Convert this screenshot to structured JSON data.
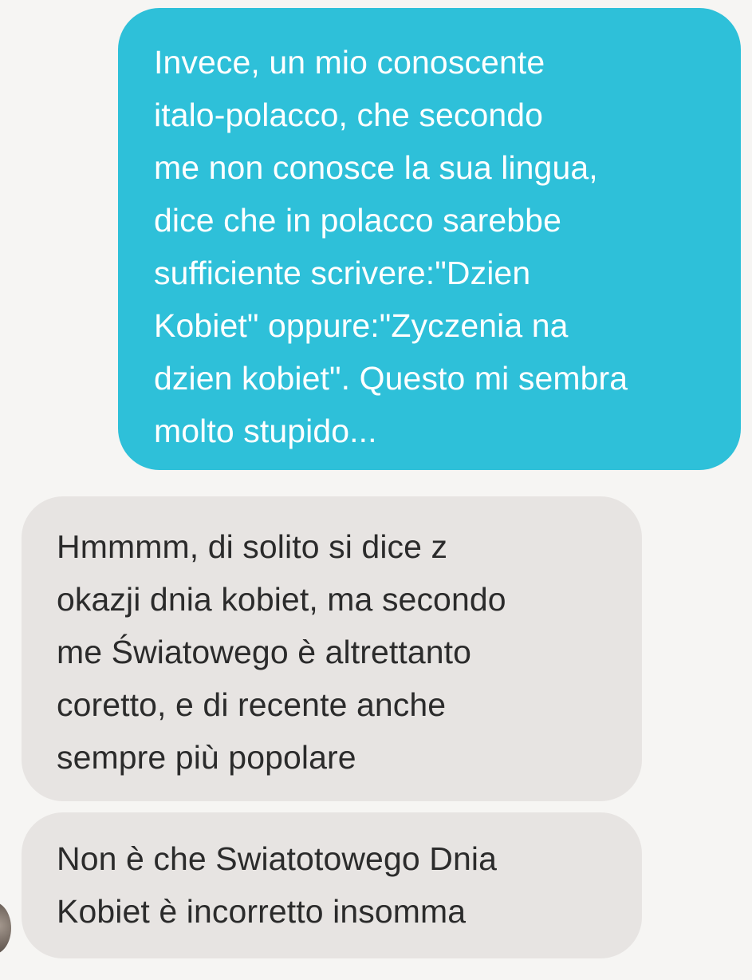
{
  "colors": {
    "background": "#f6f5f3",
    "sent_bubble": "#2ec0d9",
    "sent_text": "#ffffff",
    "received_bubble": "#e7e4e2",
    "received_text": "#2b2b2b"
  },
  "messages": [
    {
      "direction": "sent",
      "lines": [
        "Invece, un mio conoscente",
        "italo-polacco, che secondo",
        "me non conosce la sua lingua,",
        "dice che in polacco sarebbe",
        "sufficiente scrivere:\"Dzien",
        "Kobiet\" oppure:\"Zyczenia na",
        "dzien kobiet\". Questo mi sembra",
        "molto stupido..."
      ]
    },
    {
      "direction": "received",
      "lines": [
        "Hmmmm, di solito si dice z",
        "okazji dnia kobiet, ma secondo",
        "me Światowego è altrettanto",
        "coretto, e di recente anche",
        "sempre più popolare"
      ]
    },
    {
      "direction": "received",
      "lines": [
        "Non è che Swiatotowego Dnia",
        "Kobiet è incorretto insomma"
      ]
    }
  ]
}
